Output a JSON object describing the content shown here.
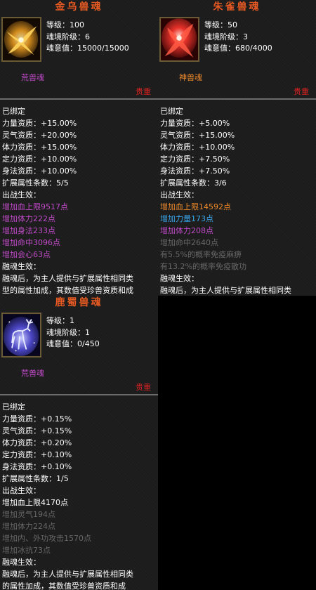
{
  "panels": [
    {
      "title": "金乌兽魂",
      "level_label": "等级：100",
      "stage_label": "魂境阶级：6",
      "soul_label": "魂意值：15000/15000",
      "quality": "荒兽魂",
      "quality_color": "#c14ac9",
      "source": "贵重",
      "bound": "已绑定",
      "attributes": [
        "力量资质：+15.00%",
        "灵气资质：+20.00%",
        "体力资质：+15.00%",
        "定力资质：+10.00%",
        "身法资质：+10.00%",
        "扩展属性条数：5/5"
      ],
      "battle_label": "出战生效：",
      "effects": [
        {
          "text": "增加血上限9517点",
          "color": "purple"
        },
        {
          "text": "增加体力222点",
          "color": "purple"
        },
        {
          "text": "增加身法233点",
          "color": "purple"
        },
        {
          "text": "增加命中3096点",
          "color": "purple"
        },
        {
          "text": "增加会心63点",
          "color": "purple"
        }
      ],
      "fusion_label": "融魂生效：",
      "fusion_lines": [
        "融魂后，为主人提供与扩展属性相同类",
        "型的属性加成，其数值受珍兽资质和成"
      ],
      "icon": "golden-crow-icon"
    },
    {
      "title": "朱雀兽魂",
      "level_label": "等级：50",
      "stage_label": "魂境阶级：3",
      "soul_label": "魂意值：680/4000",
      "quality": "神兽魂",
      "quality_color": "#f08a2a",
      "source": "贵重",
      "bound": "已绑定",
      "attributes": [
        "力量资质：+5.00%",
        "灵气资质：+15.00%",
        "体力资质：+10.00%",
        "定力资质：+7.50%",
        "身法资质：+7.50%",
        "扩展属性条数：3/6"
      ],
      "battle_label": "出战生效：",
      "effects": [
        {
          "text": "增加血上限14592点",
          "color": "orange"
        },
        {
          "text": "增加力量173点",
          "color": "blue"
        },
        {
          "text": "增加体力208点",
          "color": "purple"
        },
        {
          "text": "增加命中2640点",
          "color": "gray"
        },
        {
          "text": "有5.5%的概率免疫麻痹",
          "color": "gray"
        },
        {
          "text": "有13.2%的概率免疫散功",
          "color": "gray"
        }
      ],
      "fusion_label": "融魂生效：",
      "fusion_lines": [
        "融魂后，为主人提供与扩展属性相同类"
      ],
      "icon": "vermilion-bird-icon"
    },
    {
      "title": "鹿蜀兽魂",
      "level_label": "等级：1",
      "stage_label": "魂境阶级：1",
      "soul_label": "魂意值：0/450",
      "quality": "荒兽魂",
      "quality_color": "#c14ac9",
      "source": "贵重",
      "bound": "已绑定",
      "attributes": [
        "力量资质：+0.15%",
        "灵气资质：+0.15%",
        "体力资质：+0.20%",
        "定力资质：+0.10%",
        "身法资质：+0.10%",
        "扩展属性条数：1/5"
      ],
      "battle_label": "出战生效：",
      "effects": [
        {
          "text": "增加血上限4170点",
          "color": "white"
        },
        {
          "text": "增加灵气194点",
          "color": "gray"
        },
        {
          "text": "增加体力224点",
          "color": "gray"
        },
        {
          "text": "增加内、外功攻击1570点",
          "color": "gray"
        },
        {
          "text": "增加冰抗73点",
          "color": "gray"
        }
      ],
      "fusion_label": "融魂生效：",
      "fusion_lines": [
        "融魂后，为主人提供与扩展属性相同类",
        "的属性加成，其数值受珍兽资质和成"
      ],
      "icon": "deer-spirit-icon"
    }
  ]
}
